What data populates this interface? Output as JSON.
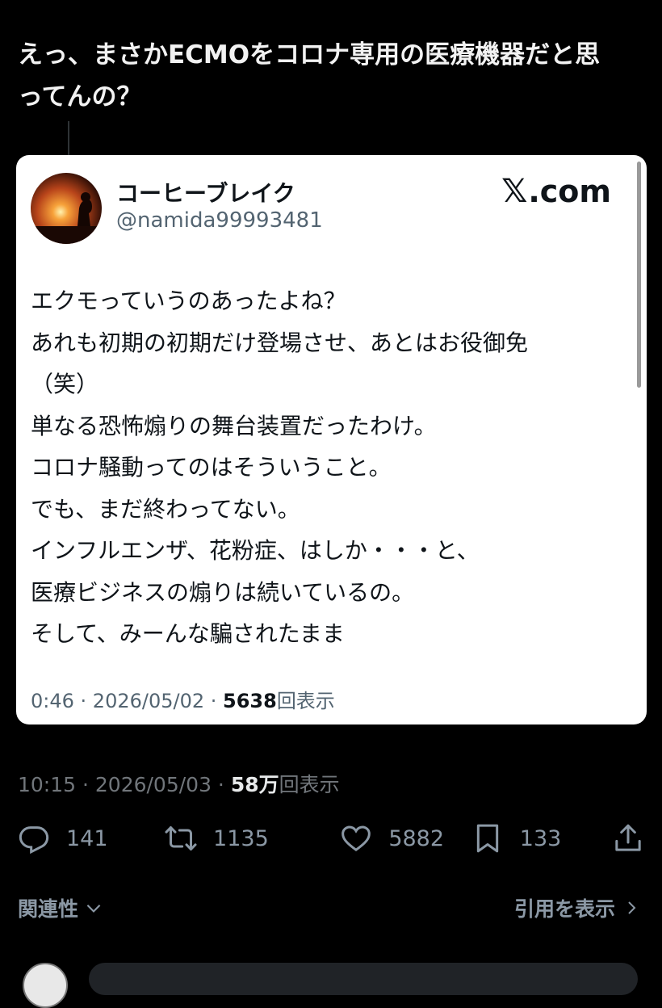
{
  "post": {
    "text": "えっ、まさかECMOをコロナ専用の医療機器だと思\nってんの？",
    "time": "10:15",
    "date": "2026/05/03",
    "views_count": "58万",
    "views_label": "回表示"
  },
  "quoted": {
    "name": "コーヒーブレイク",
    "handle": "@namida99993481",
    "source": ".com",
    "body": "エクモっていうのあったよね？\nあれも初期の初期だけ登場させ、あとはお役御免\n（笑）\n単なる恐怖煽りの舞台装置だったわけ。\nコロナ騒動ってのはそういうこと。\nでも、まだ終わってない。\nインフルエンザ、花粉症、はしか・・・と、\n医療ビジネスの煽りは続いているの。\nそして、みーんな騙されたまま",
    "time": "0:46",
    "date": "2026/05/02",
    "views_count": "5638",
    "views_label": "回表示"
  },
  "actions": {
    "replies": "141",
    "retweets": "1135",
    "likes": "5882",
    "bookmarks": "133"
  },
  "footer": {
    "related_label": "関連性",
    "quotes_label": "引用を表示"
  },
  "colors": {
    "background": "#000000",
    "card": "#ffffff",
    "muted": "#71767b"
  }
}
